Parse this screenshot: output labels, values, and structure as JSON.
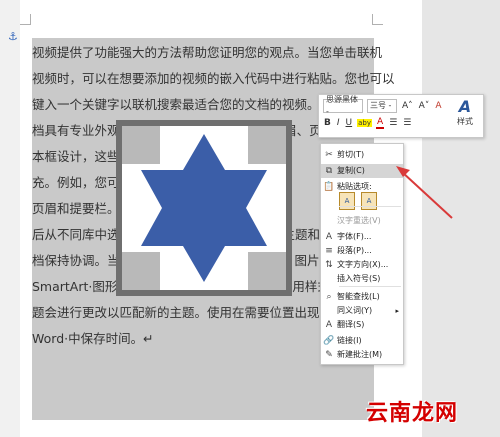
{
  "document": {
    "anchor_glyph": "⚓",
    "lines": [
      {
        "pre": "视频提供了功能强大的方法帮助您证明您的观点。当您单击联机",
        "post": ""
      },
      {
        "pre": "视频时，可以在想要添加的视频的嵌入代码中进行粘贴。您也可以",
        "post": ""
      },
      {
        "pre": "键入一个关键字以联机搜索最适合您的文档的视频。为",
        "post": ""
      },
      {
        "pre": "档具有专业外观，Word·提",
        "post": "供了页眉、页脚、封面和文"
      },
      {
        "pre": "本框设计，这些",
        "post": "设计可"
      },
      {
        "pre": "充。例如，您可以",
        "post": "添加匹配"
      },
      {
        "pre": "页眉和提要栏。",
        "post": "单击“"
      },
      {
        "pre": "后从不同库中选择所需元",
        "post": "素。主题和样式也"
      },
      {
        "pre": "档保持协调。当您单击设计并选择新的主题时，图片",
        "post": ""
      },
      {
        "pre": "SmartArt·图形将会更改以匹配新的主题。当应用样式时",
        "post": ""
      },
      {
        "pre": "题会进行更改以匹配新的主题。使用在需要位置出现的新按钮在·",
        "post": ""
      },
      {
        "pre": "Word·中保存时间。↵",
        "post": ""
      }
    ]
  },
  "mini_toolbar": {
    "font_name": "思源黑体 -",
    "font_size": "三号 -",
    "grow_font": "A˄",
    "shrink_font": "A˅",
    "clear_format": "A",
    "bold": "B",
    "italic": "I",
    "underline": "U",
    "highlight": "aby",
    "font_color": "A",
    "bullets": "☰",
    "numbering": "☰",
    "styles_label": "样式"
  },
  "context_menu": {
    "items": [
      {
        "label": "剪切(T)",
        "icon": "cut-icon",
        "glyph": "✂",
        "disabled": false
      },
      {
        "label": "复制(C)",
        "icon": "copy-icon",
        "glyph": "⧉",
        "disabled": false,
        "highlighted": true
      },
      {
        "label": "粘贴选项:",
        "icon": "paste-icon",
        "glyph": "📋",
        "disabled": false
      },
      {
        "label": "汉字重选(V)",
        "icon": "",
        "glyph": "",
        "disabled": true
      },
      {
        "label": "字体(F)...",
        "icon": "font-icon",
        "glyph": "A",
        "disabled": false
      },
      {
        "label": "段落(P)...",
        "icon": "paragraph-icon",
        "glyph": "≡",
        "disabled": false
      },
      {
        "label": "文字方向(X)...",
        "icon": "text-direction-icon",
        "glyph": "⇅",
        "disabled": false
      },
      {
        "label": "插入符号(S)",
        "icon": "",
        "glyph": "",
        "disabled": false
      },
      {
        "label": "智能查找(L)",
        "icon": "search-icon",
        "glyph": "⌕",
        "disabled": false
      },
      {
        "label": "同义词(Y)",
        "icon": "",
        "glyph": "",
        "disabled": false,
        "submenu": true
      },
      {
        "label": "翻译(S)",
        "icon": "translate-icon",
        "glyph": "A",
        "disabled": false
      },
      {
        "label": "链接(I)",
        "icon": "link-icon",
        "glyph": "🔗",
        "disabled": false
      },
      {
        "label": "新建批注(M)",
        "icon": "comment-icon",
        "glyph": "✎",
        "disabled": false
      }
    ],
    "submenu_arrow": "▸",
    "paste_option_1": "A",
    "paste_option_2": "A"
  },
  "watermark": "云南龙网",
  "colors": {
    "star": "#3b5ea8",
    "arrow": "#d93a3a",
    "watermark": "#d40000"
  }
}
